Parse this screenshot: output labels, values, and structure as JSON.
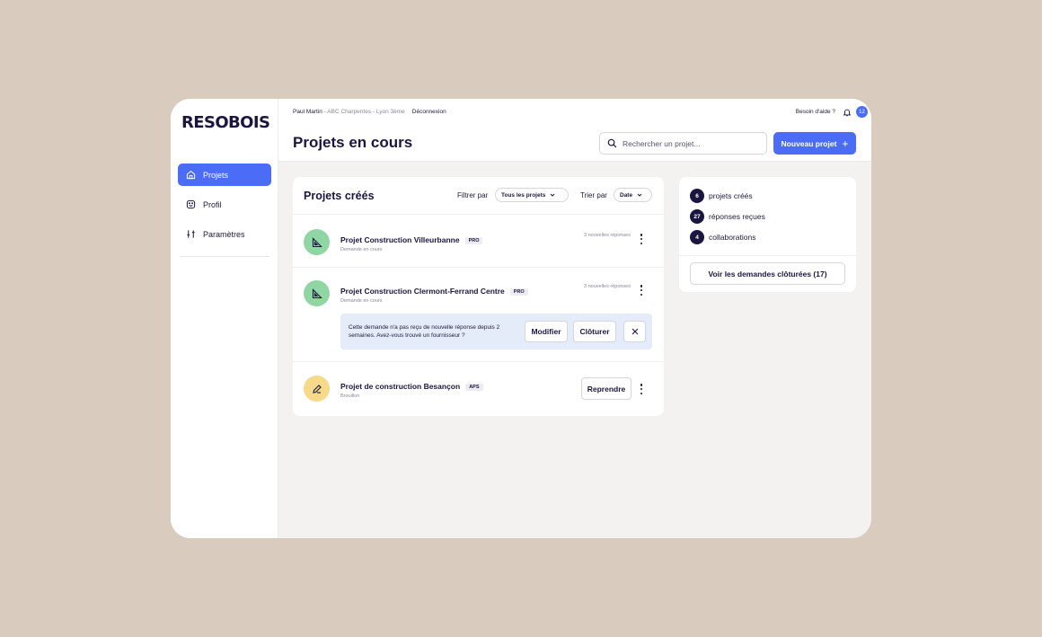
{
  "app": {
    "logo": "RESOBOIS",
    "accent": "#4a6cf7",
    "dark": "#1b1640"
  },
  "sidebar": {
    "items": [
      {
        "label": "Projets",
        "icon": "home-icon",
        "active": true
      },
      {
        "label": "Profil",
        "icon": "smiley-icon",
        "active": false
      },
      {
        "label": "Paramètres",
        "icon": "sliders-icon",
        "active": false
      }
    ]
  },
  "topbar": {
    "user": "Paul Martin",
    "company": " - ABC Charpentes - Lyon 3ème",
    "logout": "Déconnexion",
    "help": "Besoin d'aide ?",
    "notifications": "12"
  },
  "header": {
    "title": "Projets en cours",
    "search_placeholder": "Rechercher un projet...",
    "new_project": "Nouveau projet",
    "new_project_icon": "plus-icon"
  },
  "projects_card": {
    "title": "Projets créés",
    "filter_label": "Filtrer par",
    "filter_value": "Tous les projets",
    "sort_label": "Trier par",
    "sort_value": "Date",
    "items": [
      {
        "name": "Projet Construction Villeurbanne",
        "tag": "PRO",
        "status": "Demande en cours",
        "responses": "3 nouvelles réponses",
        "icon": "set-square-icon",
        "icon_bg": "#8fd6a4"
      },
      {
        "name": "Projet Construction Clermont-Ferrand Centre",
        "tag": "PRO",
        "status": "Demande en cours",
        "responses": "3 nouvelles réponses",
        "icon": "set-square-icon",
        "icon_bg": "#8fd6a4"
      },
      {
        "name": "Projet de construction Besançon",
        "tag": "APS",
        "status": "Brouillon",
        "icon": "pencil-icon",
        "icon_bg": "#f7d98a",
        "action": "Reprendre"
      }
    ],
    "alert": {
      "text": "Cette demande n'a pas reçu de nouvelle réponse depuis 2 semaines. Avez-vous trouvé un fournisseur ?",
      "modify": "Modifier",
      "close": "Clôturer"
    }
  },
  "stats": {
    "items": [
      {
        "value": "6",
        "label": "projets créés"
      },
      {
        "value": "27",
        "label": "réponses reçues"
      },
      {
        "value": "4",
        "label": "collaborations"
      }
    ],
    "closed_button": "Voir les demandes clôturées (17)"
  }
}
